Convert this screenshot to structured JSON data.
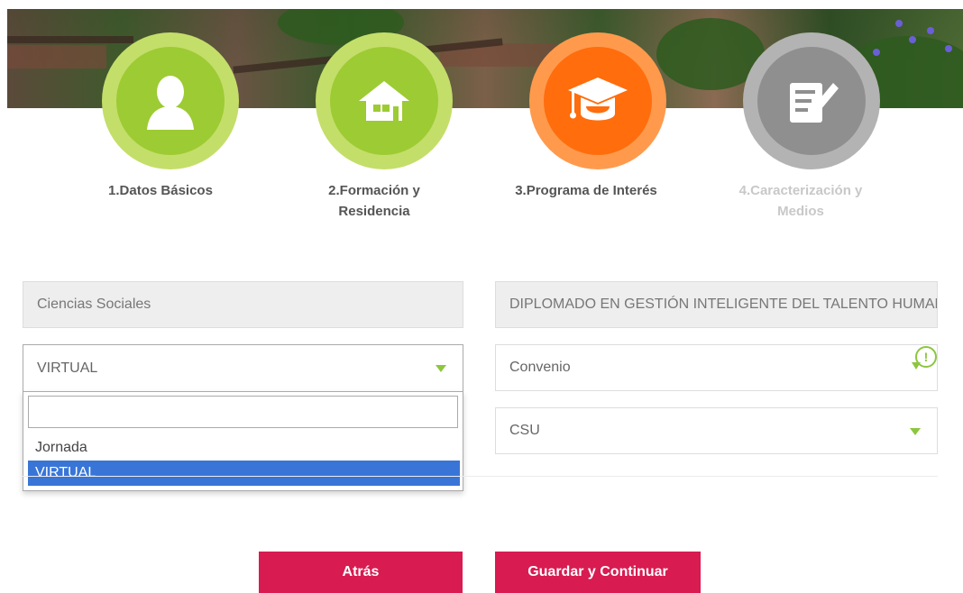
{
  "steps": [
    {
      "label": "1.Datos Básicos",
      "icon": "person-icon",
      "state": "done",
      "color": "#9dcb33"
    },
    {
      "label_line1": "2.Formación y",
      "label_line2": "Residencia",
      "icon": "house-icon",
      "state": "done",
      "color": "#9dcb33"
    },
    {
      "label": "3.Programa de Interés",
      "icon": "graduation-cap-icon",
      "state": "active",
      "color": "#ff6d0d"
    },
    {
      "label_line1": "4.Caracterización y",
      "label_line2": "Medios",
      "icon": "form-edit-icon",
      "state": "pending",
      "color": "#8f8f8f"
    }
  ],
  "form": {
    "area": "Ciencias Sociales",
    "program": "DIPLOMADO EN GESTIÓN INTELIGENTE DEL TALENTO HUMANO",
    "modality": "VIRTUAL",
    "modality_search_value": "",
    "modality_options": [
      "Jornada",
      "VIRTUAL"
    ],
    "agreement": "Convenio",
    "agreement_warning_icon": "!",
    "campus": "CSU"
  },
  "buttons": {
    "back": "Atrás",
    "save_continue": "Guardar y Continuar"
  },
  "colors": {
    "accent_green": "#8dc63f",
    "accent_orange": "#ff6d0d",
    "button": "#d81b50",
    "selected_option": "#3875d7"
  }
}
